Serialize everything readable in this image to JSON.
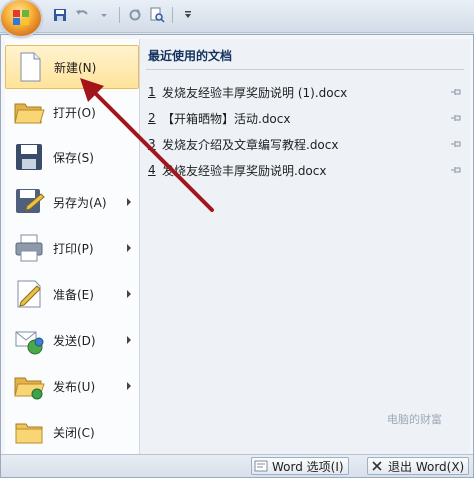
{
  "menu": {
    "items": [
      {
        "label": "新建(N)",
        "icon": "new-document-icon",
        "submenu": false
      },
      {
        "label": "打开(O)",
        "icon": "open-folder-icon",
        "submenu": false
      },
      {
        "label": "保存(S)",
        "icon": "save-icon",
        "submenu": false
      },
      {
        "label": "另存为(A)",
        "icon": "save-as-icon",
        "submenu": true
      },
      {
        "label": "打印(P)",
        "icon": "printer-icon",
        "submenu": true
      },
      {
        "label": "准备(E)",
        "icon": "prepare-icon",
        "submenu": true
      },
      {
        "label": "发送(D)",
        "icon": "send-icon",
        "submenu": true
      },
      {
        "label": "发布(U)",
        "icon": "publish-icon",
        "submenu": true
      },
      {
        "label": "关闭(C)",
        "icon": "close-folder-icon",
        "submenu": false
      }
    ]
  },
  "recent": {
    "title": "最近使用的文档",
    "docs": [
      {
        "num": "1",
        "name": "发烧友经验丰厚奖励说明 (1).docx"
      },
      {
        "num": "2",
        "name": "【开箱晒物】活动.docx"
      },
      {
        "num": "3",
        "name": "发烧友介绍及文章编写教程.docx"
      },
      {
        "num": "4",
        "name": "发烧友经验丰厚奖励说明.docx"
      }
    ]
  },
  "bottom": {
    "options_label": "Word 选项(I)",
    "exit_label": "退出 Word(X)"
  },
  "watermark": {
    "text": "电脑的财富"
  },
  "colors": {
    "annotation_arrow": "#a3151b",
    "hover_fill": "#ffe39a",
    "title_text": "#15325e"
  }
}
